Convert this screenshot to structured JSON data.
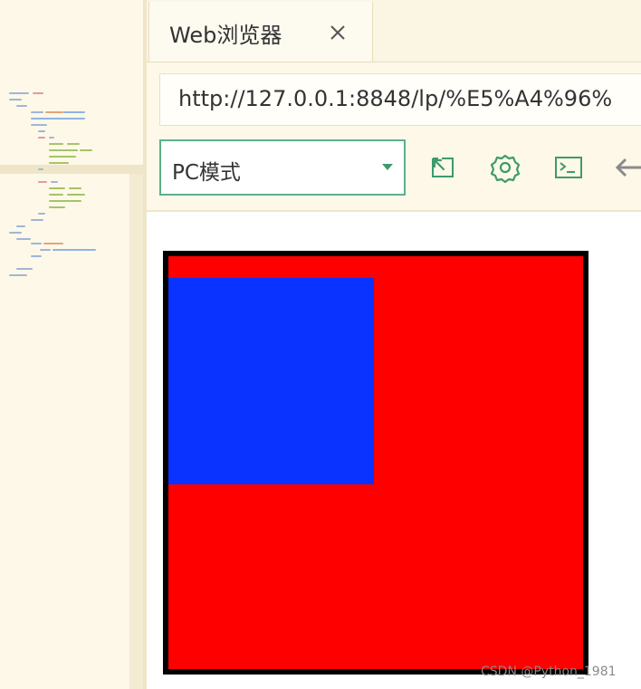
{
  "colors": {
    "accent_green": "#3e9a6c",
    "outer_box_fill": "#ff0000",
    "outer_box_border": "#000000",
    "inner_box_fill": "#0a33ff"
  },
  "tab": {
    "title": "Web浏览器",
    "close_icon": "close-icon"
  },
  "address_bar": {
    "url": "http://127.0.0.1:8848/lp/%E5%A4%96%"
  },
  "toolbar": {
    "mode_value": "PC模式",
    "mode_caret_icon": "chevron-down-icon",
    "icons": [
      "popout-icon",
      "settings-gear-icon",
      "console-icon",
      "back-arrow-icon"
    ]
  },
  "watermark": "CSDN @Python_1981"
}
